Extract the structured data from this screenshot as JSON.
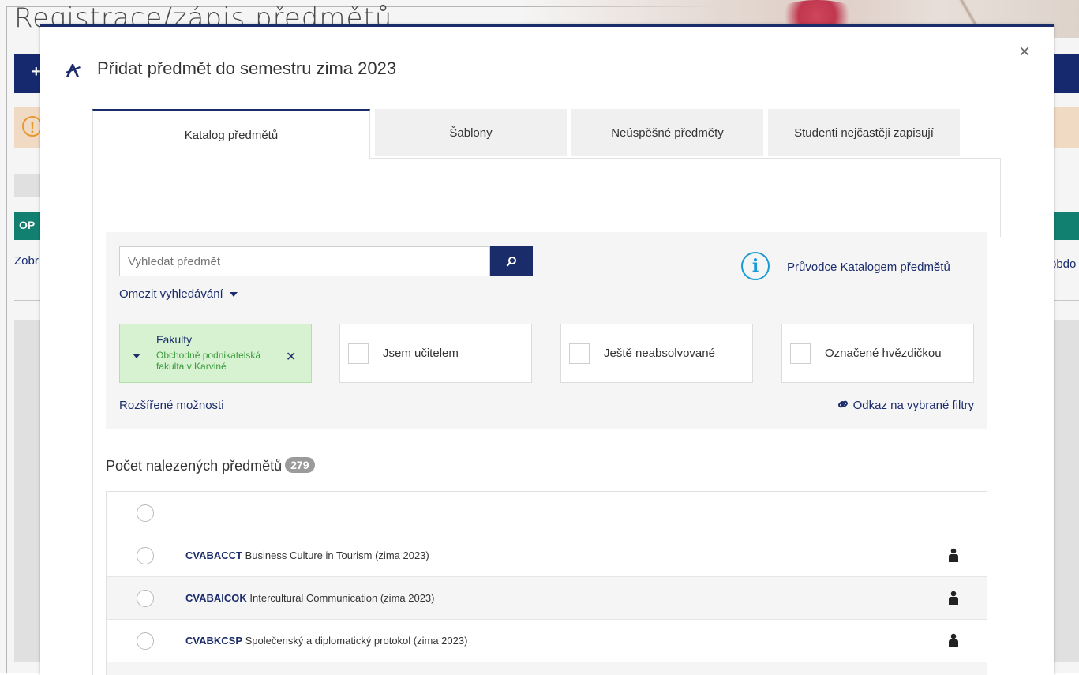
{
  "background": {
    "page_title": "Registrace/zápis předmětů",
    "left_nav_label": "OP",
    "left_link": "Zobr",
    "right_link": "obdo"
  },
  "modal": {
    "title": "Přidat předmět do semestru zima 2023",
    "close_label": "×",
    "tabs": [
      {
        "label": "Katalog předmětů",
        "active": true
      },
      {
        "label": "Šablony",
        "active": false
      },
      {
        "label": "Neúspěšné předměty",
        "active": false
      },
      {
        "label": "Studenti nejčastěji zapisují",
        "active": false
      }
    ],
    "search": {
      "placeholder": "Vyhledat předmět",
      "value": ""
    },
    "limit_search_label": "Omezit vyhledávání",
    "guide_label": "Průvodce Katalogem předmětů",
    "faculty_filter": {
      "title": "Fakulty",
      "value": "Obchodně podnikatelská fakulta v Karviné"
    },
    "checkbox_filters": [
      {
        "label": "Jsem učitelem",
        "checked": false
      },
      {
        "label": "Ještě neabsolvované",
        "checked": false
      },
      {
        "label": "Označené hvězdičkou",
        "checked": false
      }
    ],
    "advanced_options_label": "Rozšířené možnosti",
    "filter_link_label": "Odkaz na vybrané filtry",
    "results_count_label": "Počet nalezených předmětů",
    "results_count": "279",
    "courses": [
      {
        "code": "CVABACCT",
        "name": "Business Culture in Tourism (zima 2023)"
      },
      {
        "code": "CVABAICOK",
        "name": "Intercultural Communication (zima 2023)"
      },
      {
        "code": "CVABKCSP",
        "name": "Společenský a diplomatický protokol (zima 2023)"
      }
    ]
  },
  "colors": {
    "primary": "#1b2c6b",
    "info": "#1a9bd7",
    "filter_green_bg": "#d6f2d0",
    "filter_green_text": "#3a9a3a",
    "badge": "#9b9b9b"
  }
}
